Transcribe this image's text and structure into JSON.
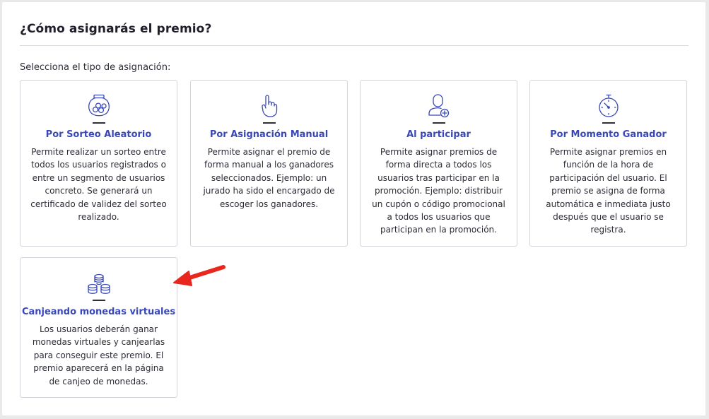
{
  "page": {
    "title": "¿Cómo asignarás el premio?",
    "subtitle": "Selecciona el tipo de asignación:"
  },
  "cards": [
    {
      "title": "Por Sorteo Aleatorio",
      "description": "Permite realizar un sorteo entre todos los usuarios registrados o entre un segmento de usuarios concreto. Se generará un certificado de validez del sorteo realizado.",
      "icon": "lottery-drum-icon"
    },
    {
      "title": "Por Asignación Manual",
      "description": "Permite asignar el premio de forma manual a los ganadores seleccionados. Ejemplo: un jurado ha sido el encargado de escoger los ganadores.",
      "icon": "hand-pointer-icon"
    },
    {
      "title": "Al participar",
      "description": "Permite asignar premios de forma directa a todos los usuarios tras participar en la promoción. Ejemplo: distribuir un cupón o código promocional a todos los usuarios que participan en la promoción.",
      "icon": "user-add-icon"
    },
    {
      "title": "Por Momento Ganador",
      "description": "Permite asignar premios en función de la hora de participación del usuario. El premio se asigna de forma automática e inmediata justo después que el usuario se registra.",
      "icon": "stopwatch-icon"
    },
    {
      "title": "Canjeando monedas virtuales",
      "description": "Los usuarios deberán ganar monedas virtuales y canjearlas para conseguir este premio. El premio aparecerá en la página de canjeo de monedas.",
      "icon": "coins-stack-icon"
    }
  ],
  "colors": {
    "accent": "#3948b8",
    "icon_stroke": "#3948b8",
    "arrow": "#e8271f"
  }
}
